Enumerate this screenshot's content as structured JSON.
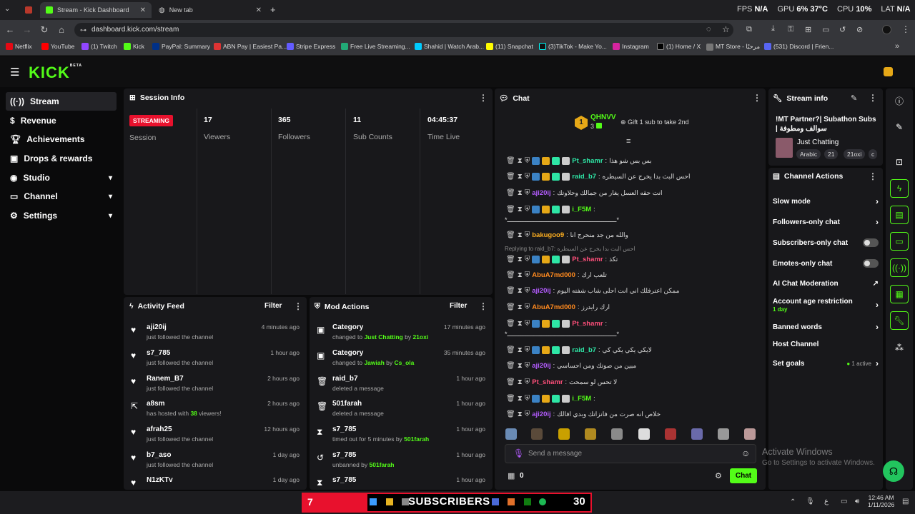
{
  "browser": {
    "tab1": "Stream - Kick Dashboard",
    "tab2": "New tab",
    "url": "dashboard.kick.com/stream",
    "stats": {
      "fps_label": "FPS",
      "fps": "N/A",
      "gpu_label": "GPU",
      "gpu": "6",
      "gpu_temp": "37",
      "cpu_label": "CPU",
      "cpu": "10",
      "lat_label": "LAT",
      "lat": "N/A"
    },
    "bookmarks": [
      "Netflix",
      "YouTube",
      "(1) Twitch",
      "Kick",
      "PayPal: Summary",
      "ABN Pay | Easiest Pa...",
      "Stripe Express",
      "Free Live Streaming...",
      "Shahid | Watch Arab...",
      "(11) Snapchat",
      "(3)TikTok - Make Yo...",
      "Instagram",
      "(1) Home / X",
      "MT Store - مرحبًا",
      "(531) Discord | Frien..."
    ]
  },
  "kick": {
    "logo": "KICK",
    "beta": "BETA"
  },
  "sidebar": [
    "Stream",
    "Revenue",
    "Achievements",
    "Drops & rewards",
    "Studio",
    "Channel",
    "Settings"
  ],
  "session": {
    "title": "Session Info",
    "badge": "STREAMING",
    "badge_label": "Session",
    "stats": [
      {
        "n": "17",
        "l": "Viewers"
      },
      {
        "n": "365",
        "l": "Followers"
      },
      {
        "n": "11",
        "l": "Sub Counts"
      },
      {
        "n": "04:45:37",
        "l": "Time Live"
      }
    ]
  },
  "activity": {
    "title": "Activity Feed",
    "filter": "Filter",
    "items": [
      {
        "name": "aji20ij",
        "sub": "just followed the channel",
        "time": "4 minutes ago"
      },
      {
        "name": "s7_785",
        "sub": "just followed the channel",
        "time": "1 hour ago"
      },
      {
        "name": "Ranem_B7",
        "sub": "just followed the channel",
        "time": "2 hours ago"
      },
      {
        "name": "a8sm",
        "sub_a": "has hosted with ",
        "sub_b": "38",
        "sub_c": " viewers!",
        "time": "2 hours ago"
      },
      {
        "name": "afrah25",
        "sub": "just followed the channel",
        "time": "12 hours ago"
      },
      {
        "name": "b7_aso",
        "sub": "just followed the channel",
        "time": "1 day ago"
      },
      {
        "name": "N1zKTv",
        "sub": "",
        "time": "1 day ago"
      }
    ]
  },
  "mod": {
    "title": "Mod Actions",
    "filter": "Filter",
    "items": [
      {
        "name": "Category",
        "a": "changed to ",
        "b": "Just Chatting",
        "c": " by ",
        "d": "21oxi",
        "time": "17 minutes ago"
      },
      {
        "name": "Category",
        "a": "changed to ",
        "b": "Jawiah",
        "c": " by ",
        "d": "Cs_ola",
        "time": "35 minutes ago"
      },
      {
        "name": "raid_b7",
        "a": "deleted a message",
        "b": "",
        "c": "",
        "d": "",
        "time": "1 hour ago"
      },
      {
        "name": "501farah",
        "a": "deleted a message",
        "b": "",
        "c": "",
        "d": "",
        "time": "1 hour ago"
      },
      {
        "name": "s7_785",
        "a": "timed out for 5 minutes by ",
        "b": "501farah",
        "c": "",
        "d": "",
        "time": "1 hour ago"
      },
      {
        "name": "s7_785",
        "a": "unbanned by ",
        "b": "501farah",
        "c": "",
        "d": "",
        "time": "1 hour ago"
      },
      {
        "name": "s7_785",
        "a": "",
        "b": "",
        "c": "",
        "d": "",
        "time": "1 hour ago"
      }
    ]
  },
  "chat": {
    "title": "Chat",
    "top_user": "QHNVV",
    "top_rank": "1",
    "top_count": "3",
    "gift": "Gift 1 sub to take 2nd",
    "reply": "Replying to raid_b7: احس البث بدا يخرج عن السيطره",
    "messages": [
      {
        "u": "Pt_shamr",
        "c": "#2ee6a6",
        "t": "بس بس شو هذا"
      },
      {
        "u": "raid_b7",
        "c": "#2ee6a6",
        "t": "احس البث بدا يخرج عن السيطره"
      },
      {
        "u": "aji20ij",
        "c": "#b45cff",
        "t": "انت حقه العسل يغار من جمالك وحلاوتك"
      },
      {
        "u": "i_F5M",
        "c": "#53fc18",
        "t": ""
      },
      {
        "u": "",
        "c": "",
        "t": "*ــــــــــــــــــــــــــــــــــــــــــــــــــــــــــ*"
      },
      {
        "u": "bakugoo9",
        "c": "#ffb020",
        "t": "والله من جد منحرج انا"
      },
      {
        "u": "Pt_shamr",
        "c": "#ff4f7a",
        "t": "تكذ"
      },
      {
        "u": "AbuA7md000",
        "c": "#ff8a1f",
        "t": "تلعب ارك"
      },
      {
        "u": "aji20ij",
        "c": "#b45cff",
        "t": "ممكن اعترفلك اني انت احلى شاب شفته اليوم"
      },
      {
        "u": "AbuA7md000",
        "c": "#ff8a1f",
        "t": "ارك رايدرز"
      },
      {
        "u": "Pt_shamr",
        "c": "#ff4f7a",
        "t": ""
      },
      {
        "u": "",
        "c": "",
        "t": "*ــــــــــــــــــــــــــــــــــــــــــــــــــــــــــ*"
      },
      {
        "u": "raid_b7",
        "c": "#2ee6a6",
        "t": "لايكي يكي يكي كي"
      },
      {
        "u": "aji20ij",
        "c": "#b45cff",
        "t": "مبين من صوتك ومن احساسي"
      },
      {
        "u": "Pt_shamr",
        "c": "#ff4f7a",
        "t": "لا تحس لو سمحت"
      },
      {
        "u": "i_F5M",
        "c": "#53fc18",
        "t": ""
      },
      {
        "u": "aji20ij",
        "c": "#b45cff",
        "t": "خلاص انه صرت من فانزاتك وبدي افالك"
      }
    ],
    "placeholder": "Send a message",
    "count": "0",
    "send": "Chat"
  },
  "streaminfo": {
    "title": "Stream info",
    "stream_title": "!MT Partner?| Subathon Subs | سوالف ومطوفة",
    "category": "Just Chatting",
    "tags": [
      "Arabic",
      "21",
      "21oxi",
      "c"
    ]
  },
  "actions": {
    "title": "Channel Actions",
    "items": [
      "Slow mode",
      "Followers-only chat",
      "Subscribers-only chat",
      "Emotes-only chat",
      "AI Chat Moderation",
      "Account age restriction",
      "Banned words",
      "Host Channel",
      "Set goals"
    ],
    "age_sub": "1 day",
    "goals_sub": "1 active"
  },
  "windows": {
    "activate": "Activate Windows",
    "activate_sub": "Go to Settings to activate Windows.",
    "time": "12:46 AM",
    "date": "1/11/2026"
  },
  "taskbar": {
    "left_num": "7",
    "sub_label": "SUBSCRIBERS",
    "right_num": "30"
  }
}
